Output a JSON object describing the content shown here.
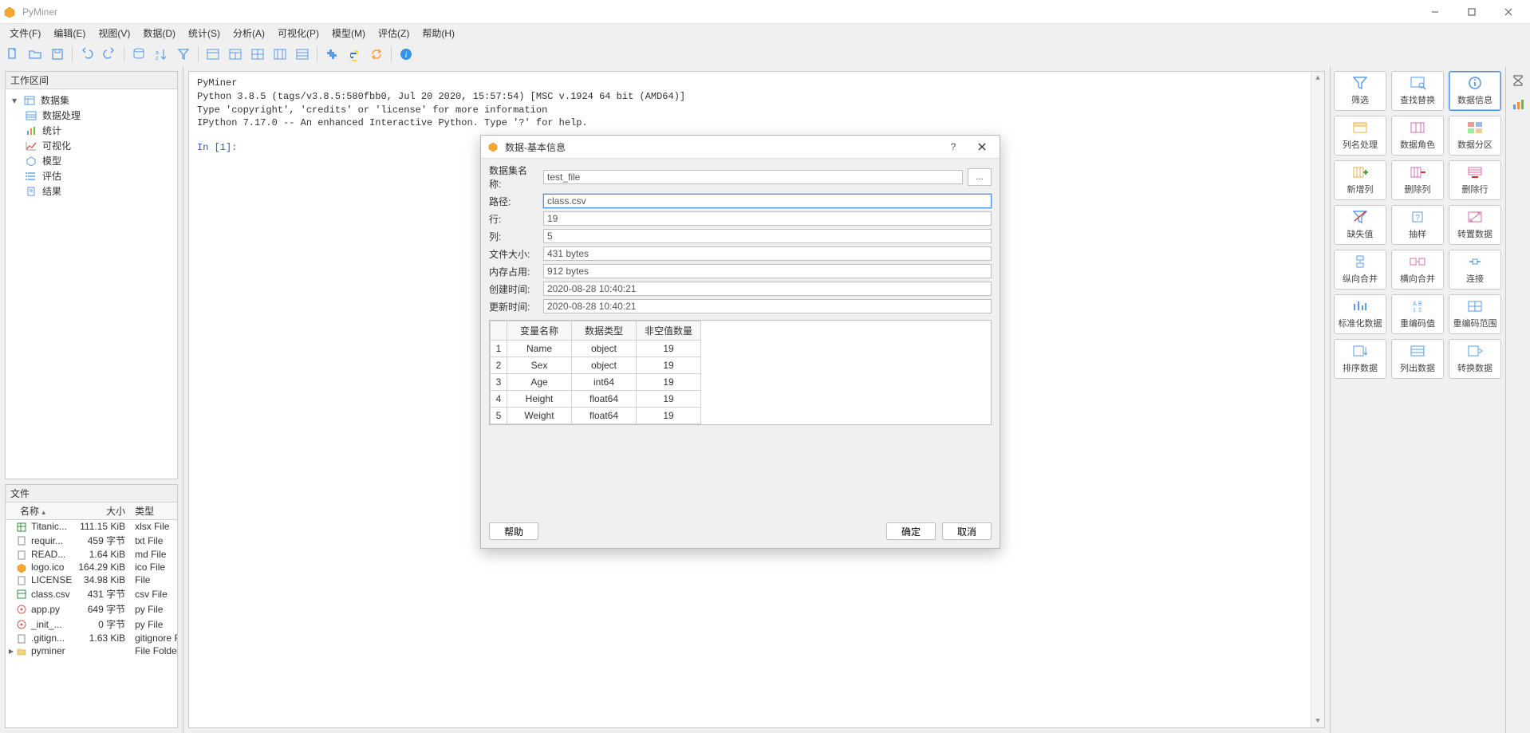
{
  "app": {
    "title": "PyMiner"
  },
  "window_controls": {
    "minimize": "minimize",
    "maximize": "maximize",
    "close": "close"
  },
  "menu": [
    "文件(F)",
    "编辑(E)",
    "视图(V)",
    "数据(D)",
    "统计(S)",
    "分析(A)",
    "可视化(P)",
    "模型(M)",
    "评估(Z)",
    "帮助(H)"
  ],
  "workspace": {
    "title": "工作区间",
    "root": "数据集",
    "children": [
      "数据处理",
      "统计",
      "可视化",
      "模型",
      "评估",
      "结果"
    ]
  },
  "file_pane": {
    "title": "文件",
    "columns": [
      "名称",
      "大小",
      "类型"
    ],
    "rows": [
      {
        "kind": "xlsx",
        "name": "Titanic...",
        "size": "111.15 KiB",
        "type": "xlsx File"
      },
      {
        "kind": "txt",
        "name": "requir...",
        "size": "459 字节",
        "type": "txt File"
      },
      {
        "kind": "md",
        "name": "READ...",
        "size": "1.64 KiB",
        "type": "md File"
      },
      {
        "kind": "ico",
        "name": "logo.ico",
        "size": "164.29 KiB",
        "type": "ico File"
      },
      {
        "kind": "blank",
        "name": "LICENSE",
        "size": "34.98 KiB",
        "type": "File"
      },
      {
        "kind": "csv",
        "name": "class.csv",
        "size": "431 字节",
        "type": "csv File"
      },
      {
        "kind": "py",
        "name": "app.py",
        "size": "649 字节",
        "type": "py File"
      },
      {
        "kind": "py",
        "name": "_init_...",
        "size": "0 字节",
        "type": "py File"
      },
      {
        "kind": "gitignore",
        "name": ".gitign...",
        "size": "1.63 KiB",
        "type": "gitignore Fi"
      },
      {
        "kind": "folder",
        "name": "pyminer",
        "size": "",
        "type": "File Folder"
      }
    ]
  },
  "console": {
    "lines": [
      "PyMiner",
      "Python 3.8.5 (tags/v3.8.5:580fbb0, Jul 20 2020, 15:57:54) [MSC v.1924 64 bit (AMD64)]",
      "Type 'copyright', 'credits' or 'license' for more information",
      "IPython 7.17.0 -- An enhanced Interactive Python. Type '?' for help."
    ],
    "prompt": "In [1]:"
  },
  "palette": [
    {
      "key": "filter",
      "label": "筛选"
    },
    {
      "key": "find-replace",
      "label": "查找替换"
    },
    {
      "key": "data-info",
      "label": "数据信息",
      "active": true
    },
    {
      "key": "col-name",
      "label": "列名处理"
    },
    {
      "key": "data-role",
      "label": "数据角色"
    },
    {
      "key": "data-partition",
      "label": "数据分区"
    },
    {
      "key": "add-col",
      "label": "新增列"
    },
    {
      "key": "del-col",
      "label": "删除列"
    },
    {
      "key": "del-row",
      "label": "删除行"
    },
    {
      "key": "missing",
      "label": "缺失值"
    },
    {
      "key": "sample",
      "label": "抽样"
    },
    {
      "key": "transpose",
      "label": "转置数据"
    },
    {
      "key": "vmerge",
      "label": "纵向合并"
    },
    {
      "key": "hmerge",
      "label": "横向合并"
    },
    {
      "key": "connect",
      "label": "连接"
    },
    {
      "key": "standardize",
      "label": "标准化数据"
    },
    {
      "key": "recode-val",
      "label": "重编码值"
    },
    {
      "key": "recode-range",
      "label": "重编码范围"
    },
    {
      "key": "sort-data",
      "label": "排序数据"
    },
    {
      "key": "list-data",
      "label": "列出数据"
    },
    {
      "key": "transform",
      "label": "转换数据"
    }
  ],
  "dialog": {
    "title": "数据-基本信息",
    "help_btn": "?",
    "close_btn": "×",
    "browse_btn": "...",
    "fields": {
      "dataset_name": {
        "label": "数据集名称:",
        "value": "test_file"
      },
      "path": {
        "label": "路径:",
        "value": "class.csv"
      },
      "rows": {
        "label": "行:",
        "value": "19"
      },
      "cols": {
        "label": "列:",
        "value": "5"
      },
      "file_size": {
        "label": "文件大小:",
        "value": "431 bytes"
      },
      "mem_usage": {
        "label": "内存占用:",
        "value": "912 bytes"
      },
      "created": {
        "label": "创建时间:",
        "value": "2020-08-28 10:40:21"
      },
      "updated": {
        "label": "更新时间:",
        "value": "2020-08-28 10:40:21"
      }
    },
    "vars": {
      "columns": [
        "变量名称",
        "数据类型",
        "非空值数量"
      ],
      "rows": [
        {
          "name": "Name",
          "dtype": "object",
          "count": "19"
        },
        {
          "name": "Sex",
          "dtype": "object",
          "count": "19"
        },
        {
          "name": "Age",
          "dtype": "int64",
          "count": "19"
        },
        {
          "name": "Height",
          "dtype": "float64",
          "count": "19"
        },
        {
          "name": "Weight",
          "dtype": "float64",
          "count": "19"
        }
      ]
    },
    "buttons": {
      "help": "帮助",
      "ok": "确定",
      "cancel": "取消"
    }
  }
}
